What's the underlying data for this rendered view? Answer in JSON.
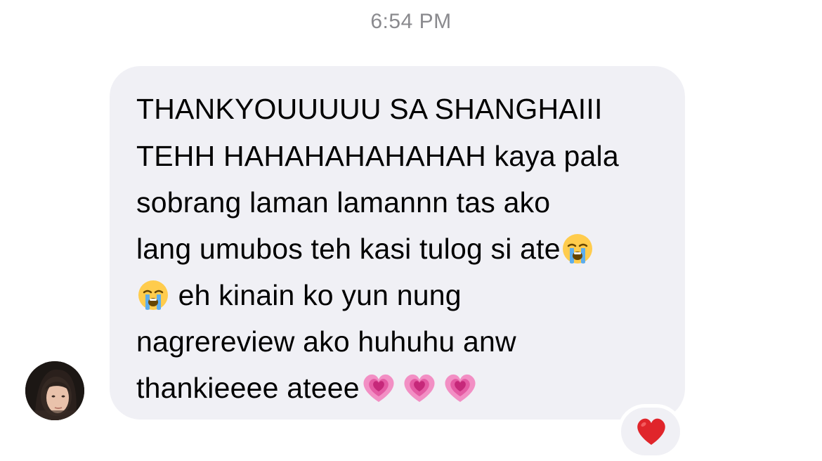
{
  "timestamp": "6:54 PM",
  "message": {
    "lines": [
      {
        "before": "THANKYOUUUUU SA SHANGHAIII",
        "after": ""
      },
      {
        "before": "TEHH HAHAHAHAHAHAH kaya pala",
        "after": ""
      },
      {
        "before": "sobrang laman lamannn tas ako",
        "after": ""
      },
      {
        "before": "lang umubos teh kasi tulog si ate",
        "after": ""
      },
      {
        "before": "",
        "after": " eh kinain ko yun nung"
      },
      {
        "before": "nagrereview ako huhuhu anw",
        "after": ""
      },
      {
        "before": "thankieeee ateee",
        "after": ""
      }
    ],
    "emojis": {
      "crying": "loudly-crying-face-emoji",
      "heart": "growing-heart-emoji"
    }
  },
  "reaction": {
    "emoji": "red-heart-emoji",
    "color": "#e0252b"
  },
  "colors": {
    "bubble": "#f0f0f5",
    "timestamp": "#8a8a8e",
    "text": "#000000"
  }
}
